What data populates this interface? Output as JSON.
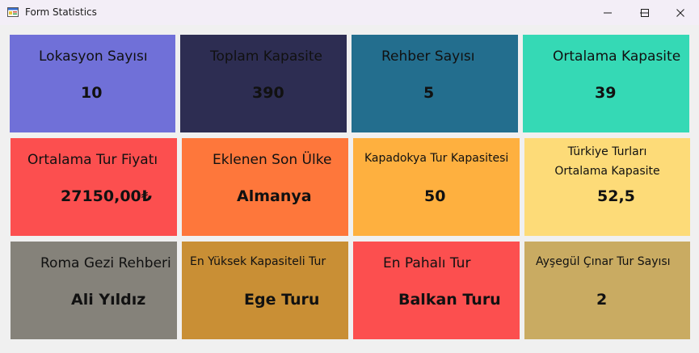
{
  "window": {
    "title": "Form Statistics",
    "icon": "winforms-app-icon",
    "controls": [
      "minimize-icon",
      "maximize-icon",
      "close-icon"
    ]
  },
  "colors": {
    "lokasyon": "#7070d8",
    "toplam_kapasite": "#2d2d52",
    "rehber": "#236e8e",
    "ortalama_kapasite": "#35d9b5",
    "ortalama_fiyat": "#fc4f4f",
    "son_ulke": "#fe773b",
    "kapadokya": "#feb03f",
    "turkiye": "#fddb78",
    "roma": "#85827a",
    "en_yuksek": "#c98f35",
    "en_pahali": "#fc4f4f",
    "aysegul": "#c9ab62"
  },
  "stats": {
    "lokasyon_sayisi": {
      "label": "Lokasyon Sayısı",
      "value": "10"
    },
    "toplam_kapasite": {
      "label": "Toplam Kapasite",
      "value": "390"
    },
    "rehber_sayisi": {
      "label": "Rehber Sayısı",
      "value": "5"
    },
    "ortalama_kapasite": {
      "label": "Ortalama Kapasite",
      "value": "39"
    },
    "ortalama_tur_fiyati": {
      "label": "Ortalama Tur Fiyatı",
      "value": "27150,00₺"
    },
    "eklenen_son_ulke": {
      "label": "Eklenen Son Ülke",
      "value": "Almanya"
    },
    "kapadokya_tur_kapasitesi": {
      "label": "Kapadokya Tur Kapasitesi",
      "value": "50"
    },
    "turkiye_turlari": {
      "label_line1": "Türkiye Turları",
      "label_line2": "Ortalama Kapasite",
      "value": "52,5"
    },
    "roma_gezi_rehberi": {
      "label": "Roma Gezi Rehberi",
      "value": "Ali Yıldız"
    },
    "en_yuksek_kapasiteli_tur": {
      "label": "En Yüksek Kapasiteli Tur",
      "value": "Ege Turu"
    },
    "en_pahali_tur": {
      "label": "En Pahalı Tur",
      "value": "Balkan Turu"
    },
    "aysegul_cinar_tur_sayisi": {
      "label": "Ayşegül Çınar Tur Sayısı",
      "value": "2"
    }
  }
}
